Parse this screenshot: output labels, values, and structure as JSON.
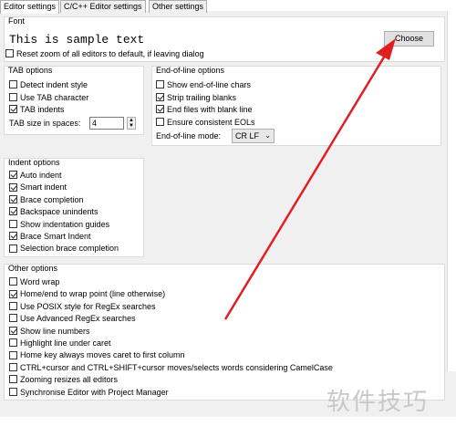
{
  "tabs": [
    "Editor settings",
    "C/C++ Editor settings",
    "Other settings"
  ],
  "font": {
    "title": "Font",
    "sample": "This is sample text",
    "choose": "Choose",
    "reset_zoom": {
      "label": "Reset zoom of all editors to default, if leaving dialog",
      "checked": false
    }
  },
  "tab_options": {
    "title": "TAB options",
    "items": [
      {
        "label": "Detect indent style",
        "checked": false
      },
      {
        "label": "Use TAB character",
        "checked": false
      },
      {
        "label": "TAB indents",
        "checked": true
      }
    ],
    "size_label": "TAB size in spaces:",
    "size_value": "4"
  },
  "eol_options": {
    "title": "End-of-line options",
    "items": [
      {
        "label": "Show end-of-line chars",
        "checked": false
      },
      {
        "label": "Strip trailing blanks",
        "checked": true
      },
      {
        "label": "End files with blank line",
        "checked": true
      },
      {
        "label": "Ensure consistent EOLs",
        "checked": false
      }
    ],
    "mode_label": "End-of-line mode:",
    "mode_value": "CR LF"
  },
  "indent_options": {
    "title": "Indent options",
    "items": [
      {
        "label": "Auto indent",
        "checked": true
      },
      {
        "label": "Smart indent",
        "checked": true
      },
      {
        "label": "Brace completion",
        "checked": true
      },
      {
        "label": "Backspace unindents",
        "checked": true
      },
      {
        "label": "Show indentation guides",
        "checked": false
      },
      {
        "label": "Brace Smart Indent",
        "checked": true
      },
      {
        "label": "Selection brace completion",
        "checked": false
      }
    ]
  },
  "other_options": {
    "title": "Other options",
    "items": [
      {
        "label": "Word wrap",
        "checked": false
      },
      {
        "label": "Home/end to wrap point (line otherwise)",
        "checked": true
      },
      {
        "label": "Use POSIX style for RegEx searches",
        "checked": false
      },
      {
        "label": "Use Advanced RegEx searches",
        "checked": false
      },
      {
        "label": "Show line numbers",
        "checked": true
      },
      {
        "label": "Highlight line under caret",
        "checked": false
      },
      {
        "label": "Home key always moves caret to first column",
        "checked": false
      },
      {
        "label": "CTRL+cursor and CTRL+SHIFT+cursor moves/selects words considering CamelCase",
        "checked": false
      },
      {
        "label": "Zooming resizes all editors",
        "checked": false
      },
      {
        "label": "Synchronise Editor with Project Manager",
        "checked": false
      }
    ]
  },
  "watermark": "软件技巧",
  "colors": {
    "arrow": "#e02020"
  }
}
